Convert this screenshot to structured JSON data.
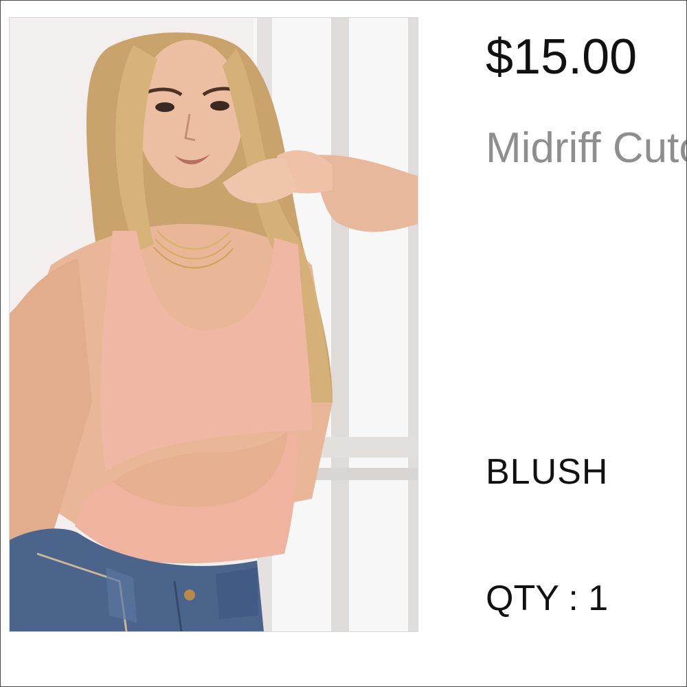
{
  "product": {
    "price": "$15.00",
    "name": "Midriff Cutout Bodysuit",
    "color": "BLUSH",
    "quantity_label": "QTY : 1"
  },
  "image": {
    "subject": "model-wearing-blush-cutout-bodysuit",
    "garment_color": "#f0b8a4",
    "denim_color": "#4a648c",
    "background_color": "#f3f0ef"
  }
}
